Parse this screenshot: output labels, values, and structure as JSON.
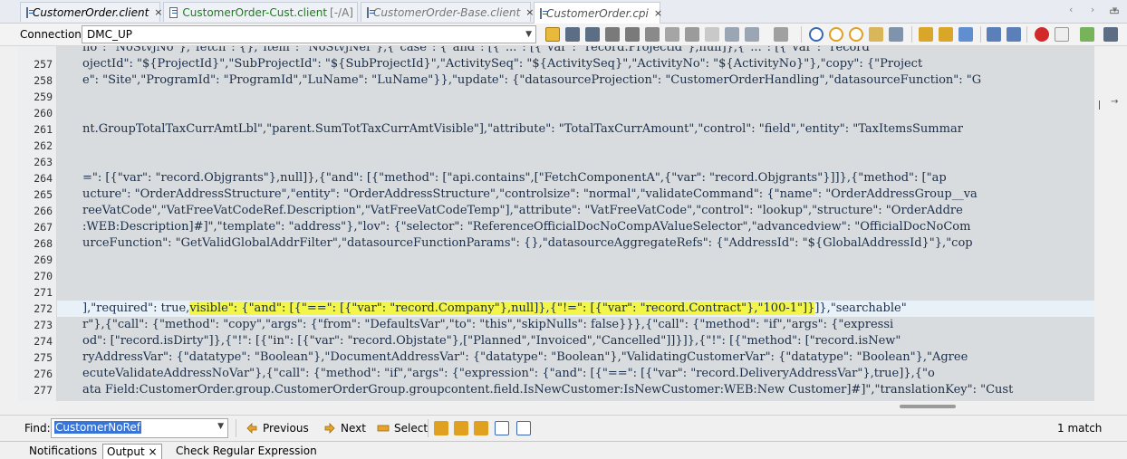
{
  "tabs": [
    {
      "label": "CustomerOrder.client",
      "style": "normal",
      "close": "×",
      "suffix": ""
    },
    {
      "label": "CustomerOrder-Cust.client",
      "style": "green",
      "close": "",
      "suffix": "[-/A]"
    },
    {
      "label": "CustomerOrder-Base.client",
      "style": "gray",
      "close": "×",
      "suffix": ""
    },
    {
      "label": "CustomerOrder.cpi",
      "style": "blue",
      "close": "×",
      "suffix": ""
    }
  ],
  "tab_nav": "‹ › ▾",
  "tab_ctl": "▭",
  "connection": {
    "label": "Connection:",
    "value": "DMC_UP"
  },
  "editor": {
    "lines": [
      {
        "no": "",
        "text": "no\": \"NoStvjNo\"},\"fetch\": {},\"ltem\": \"NoStvjNef\"},{\"case\": {\"and\": [{\"...\": [{\"var\": \"record.Projectid\"},null]},{\"...\": [{\"var\": \"record"
      },
      {
        "no": "257",
        "text": "ojectId\": \"${ProjectId}\",\"SubProjectId\": \"${SubProjectId}\",\"ActivitySeq\": \"${ActivitySeq}\",\"ActivityNo\": \"${ActivityNo}\"},\"copy\": {\"Project"
      },
      {
        "no": "258",
        "text": "e\": \"Site\",\"ProgramId\": \"ProgramId\",\"LuName\": \"LuName\"}},\"update\": {\"datasourceProjection\": \"CustomerOrderHandling\",\"datasourceFunction\": \"G"
      },
      {
        "no": "259",
        "text": ""
      },
      {
        "no": "260",
        "text": ""
      },
      {
        "no": "261",
        "text": "nt.GroupTotalTaxCurrAmtLbl\",\"parent.SumTotTaxCurrAmtVisible\"],\"attribute\": \"TotalTaxCurrAmount\",\"control\": \"field\",\"entity\": \"TaxItemsSummar"
      },
      {
        "no": "262",
        "text": ""
      },
      {
        "no": "263",
        "text": ""
      },
      {
        "no": "264",
        "text": "=\": [{\"var\": \"record.Objgrants\"},null]},{\"and\": [{\"method\": [\"api.contains\",[\"FetchComponentA\",{\"var\": \"record.Objgrants\"}]]},{\"method\": [\"ap"
      },
      {
        "no": "265",
        "text": "ucture\": \"OrderAddressStructure\",\"entity\": \"OrderAddressStructure\",\"controlsize\": \"normal\",\"validateCommand\": {\"name\": \"OrderAddressGroup__va"
      },
      {
        "no": "266",
        "text": "reeVatCode\",\"VatFreeVatCodeRef.Description\",\"VatFreeVatCodeTemp\"],\"attribute\": \"VatFreeVatCode\",\"control\": \"lookup\",\"structure\": \"OrderAddre"
      },
      {
        "no": "267",
        "text": ":WEB:Description]#]\",\"template\": \"address\"},\"lov\": {\"selector\": \"ReferenceOfficialDocNoCompAValueSelector\",\"advancedview\": \"OfficialDocNoCom"
      },
      {
        "no": "268",
        "text": "urceFunction\": \"GetValidGlobalAddrFilter\",\"datasourceFunctionParams\": {},\"datasourceAggregateRefs\": {\"AddressId\": \"${GlobalAddressId}\"},\"cop"
      },
      {
        "no": "269",
        "text": ""
      },
      {
        "no": "270",
        "text": ""
      },
      {
        "no": "271",
        "text": ""
      },
      {
        "no": "272",
        "text_pre": "],\"required\": true,",
        "text_hl": "visible\": {\"and\": [{\"==\": [{\"var\": \"record.Company\"},null]},{\"!=\": [{\"var\": \"record.Contract\"},\"100-1\"]}",
        "text_post": "]},\"searchable\""
      },
      {
        "no": "273",
        "text": "r\"},{\"call\": {\"method\": \"copy\",\"args\": {\"from\": \"DefaultsVar\",\"to\": \"this\",\"skipNulls\": false}}},{\"call\": {\"method\": \"if\",\"args\": {\"expressi"
      },
      {
        "no": "274",
        "text": "od\": [\"record.isDirty\"]},{\"!\": [{\"in\": [{\"var\": \"record.Objstate\"},[\"Planned\",\"Invoiced\",\"Cancelled\"]]}]},{\"!\": [{\"method\": [\"record.isNew\""
      },
      {
        "no": "275",
        "text": "ryAddressVar\": {\"datatype\": \"Boolean\"},\"DocumentAddressVar\": {\"datatype\": \"Boolean\"},\"ValidatingCustomerVar\": {\"datatype\": \"Boolean\"},\"Agree"
      },
      {
        "no": "276",
        "text": "ecuteValidateAddressNoVar\"},{\"call\": {\"method\": \"if\",\"args\": {\"expression\": {\"and\": [{\"==\": [{\"var\": \"record.DeliveryAddressVar\"},true]},{\"o"
      },
      {
        "no": "277",
        "text": "ata Field:CustomerOrder.group.CustomerOrderGroup.groupcontent.field.IsNewCustomer:IsNewCustomer:WEB:New Customer]#]\",\"translationKey\": \"Cust"
      }
    ]
  },
  "find": {
    "label": "Find:",
    "value": "CustomerNoRef",
    "previous_label": "Previous",
    "next_label": "Next",
    "select_label": "Select",
    "match_count": "1 match"
  },
  "bottom_tabs": [
    {
      "label": "Notifications",
      "active": false
    },
    {
      "label": "Output",
      "active": true
    },
    {
      "label": "Check Regular Expression",
      "active": false
    }
  ],
  "colors": {
    "highlight": "#f3f54a",
    "code_bg": "#d9dcdf",
    "find_selection": "#3875d7"
  }
}
